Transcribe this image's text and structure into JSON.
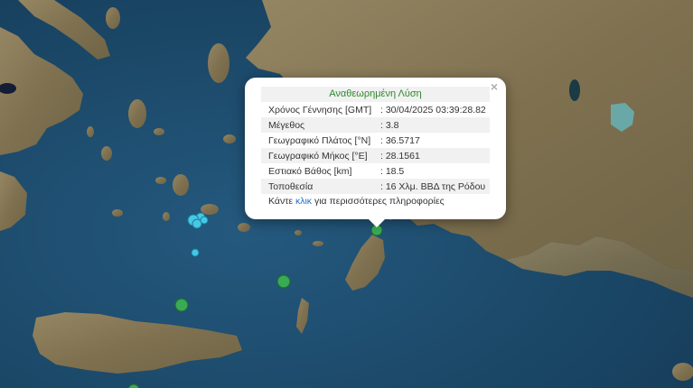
{
  "popup": {
    "title": "Αναθεωρημένη Λύση",
    "close_glyph": "×",
    "rows": [
      {
        "label": "Χρόνος Γέννησης [GMT]",
        "value": ": 30/04/2025 03:39:28.82"
      },
      {
        "label": "Μέγεθος",
        "value": ": 3.8"
      },
      {
        "label": "Γεωγραφικό Πλάτος [°N]",
        "value": ": 36.5717"
      },
      {
        "label": "Γεωγραφικό Μήκος [°E]",
        "value": ": 28.1561"
      },
      {
        "label": "Εστιακό Βάθος [km]",
        "value": ": 18.5"
      },
      {
        "label": "Τοποθεσία",
        "value": ": 16 Χλμ. ΒΒΔ της Ρόδου"
      }
    ],
    "more_prefix": "Κάντε ",
    "more_link": "κλικ",
    "more_suffix": " για περισσότερες πληροφορίες"
  },
  "colors": {
    "sea": "#1d4a6b",
    "land": "#8a7c56",
    "marker_green": "#3aaa55",
    "marker_cyan": "#45c8e6",
    "popup_title": "#2b8a2b",
    "link": "#1f6ecc"
  }
}
